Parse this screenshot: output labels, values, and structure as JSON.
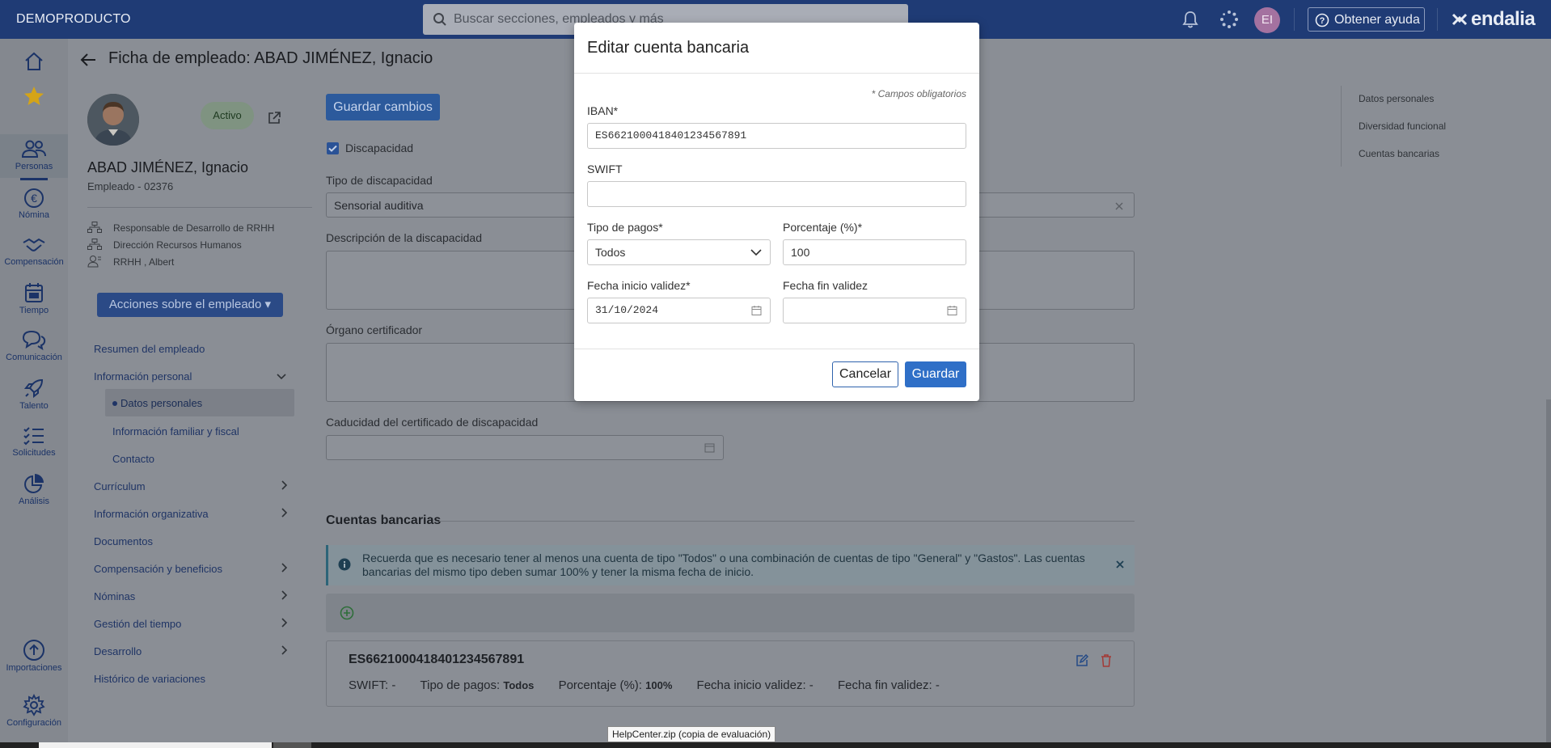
{
  "topbar": {
    "brand": "DEMOPRODUCTO",
    "search_placeholder": "Buscar secciones, empleados y más",
    "avatar_initials": "EI",
    "help_label": "Obtener ayuda",
    "logo_text": "endalia"
  },
  "rail": {
    "items": [
      {
        "label": ""
      },
      {
        "label": ""
      },
      {
        "label": "Personas"
      },
      {
        "label": "Nómina"
      },
      {
        "label": "Compensación"
      },
      {
        "label": "Tiempo"
      },
      {
        "label": "Comunicación"
      },
      {
        "label": "Talento"
      },
      {
        "label": "Solicitudes"
      },
      {
        "label": "Análisis"
      },
      {
        "label": "Importaciones"
      },
      {
        "label": "Configuración"
      }
    ]
  },
  "header": {
    "page_title": "Ficha de empleado: ABAD JIMÉNEZ, Ignacio"
  },
  "employee": {
    "status": "Activo",
    "name": "ABAD JIMÉNEZ, Ignacio",
    "code": "Empleado - 02376",
    "position": "Responsable de Desarrollo de RRHH",
    "department": "Dirección Recursos Humanos",
    "manager": "RRHH , Albert",
    "actions_label": "Acciones sobre el empleado ▾"
  },
  "menu": {
    "items": [
      {
        "label": "Resumen del empleado"
      },
      {
        "label": "Información personal"
      },
      {
        "label": "Datos personales"
      },
      {
        "label": "Información familiar y fiscal"
      },
      {
        "label": "Contacto"
      },
      {
        "label": "Currículum"
      },
      {
        "label": "Información organizativa"
      },
      {
        "label": "Documentos"
      },
      {
        "label": "Compensación y beneficios"
      },
      {
        "label": "Nóminas"
      },
      {
        "label": "Gestión del tiempo"
      },
      {
        "label": "Desarrollo"
      },
      {
        "label": "Histórico de variaciones"
      }
    ]
  },
  "form": {
    "save_label": "Guardar cambios",
    "disability_checkbox": "Discapacidad",
    "disability_type_label": "Tipo de discapacidad",
    "disability_type_value": "Sensorial auditiva",
    "disability_desc_label": "Descripción de la discapacidad",
    "certifier_label": "Órgano certificador",
    "cert_expiry_label": "Caducidad del certificado de discapacidad"
  },
  "bank": {
    "section_title": "Cuentas bancarias",
    "info_text_line1": "Recuerda que es necesario tener al menos una cuenta de tipo \"Todos\" o una combinación de cuentas de tipo \"General\" y \"Gastos\". Las cuentas",
    "info_text_line2": "bancarias del mismo tipo deben sumar 100% y tener la misma fecha de inicio.",
    "account": {
      "iban": "ES6621000418401234567891",
      "swift_label": "SWIFT:",
      "swift_value": "-",
      "payment_type_label": "Tipo de pagos:",
      "payment_type_value": "Todos",
      "percent_label": "Porcentaje (%):",
      "percent_value": "100%",
      "start_label": "Fecha inicio validez:",
      "start_value": "-",
      "end_label": "Fecha fin validez:",
      "end_value": "-"
    }
  },
  "toc": {
    "items": [
      {
        "label": "Datos personales"
      },
      {
        "label": "Diversidad funcional"
      },
      {
        "label": "Cuentas bancarias"
      }
    ]
  },
  "modal": {
    "title": "Editar cuenta bancaria",
    "required_note": "* Campos obligatorios",
    "iban_label": "IBAN*",
    "iban_value": "ES6621000418401234567891",
    "swift_label": "SWIFT",
    "swift_value": "",
    "payment_type_label": "Tipo de pagos*",
    "payment_type_value": "Todos",
    "percent_label": "Porcentaje (%)*",
    "percent_value": "100",
    "start_label": "Fecha inicio validez*",
    "start_value": "31/10/2024",
    "end_label": "Fecha fin validez",
    "end_value": "",
    "cancel_label": "Cancelar",
    "save_label": "Guardar"
  },
  "taskbar": {
    "tooltip": "HelpCenter.zip (copia de evaluación)"
  }
}
